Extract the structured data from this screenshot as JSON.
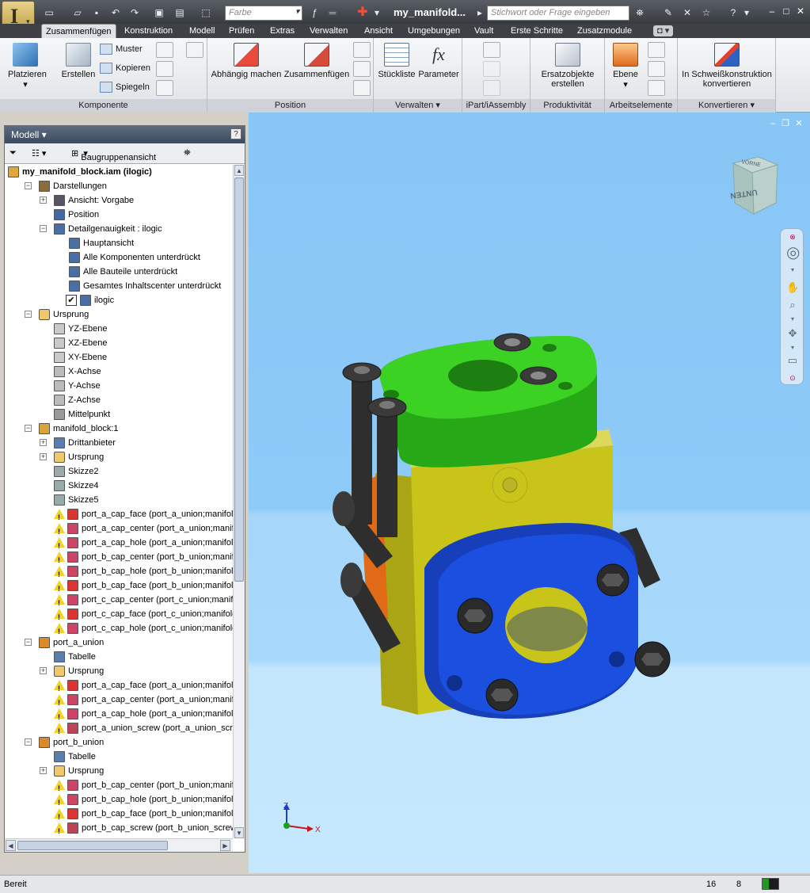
{
  "titlebar": {
    "app_icon": "inventor-app-icon",
    "color_placeholder": "Farbe",
    "doc_title": "my_manifold...",
    "search_placeholder": "Stichwort oder Frage eingeben"
  },
  "tabs": [
    "Zusammenfügen",
    "Konstruktion",
    "Modell",
    "Prüfen",
    "Extras",
    "Verwalten",
    "Ansicht",
    "Umgebungen",
    "Vault",
    "Erste Schritte",
    "Zusatzmodule"
  ],
  "ribbon": {
    "groups": {
      "komponente": "Komponente",
      "position": "Position",
      "verwalten": "Verwalten",
      "ipart": "iPart/iAssembly",
      "produktivitaet": "Produktivität",
      "arbeitselemente": "Arbeitselemente",
      "konvertieren": "Konvertieren"
    },
    "platzieren": "Platzieren",
    "erstellen": "Erstellen",
    "muster": "Muster",
    "kopieren": "Kopieren",
    "spiegeln": "Spiegeln",
    "abhaengig": "Abhängig machen",
    "zusammenfuegen": "Zusammenfügen",
    "stueckliste": "Stückliste",
    "parameter": "Parameter",
    "ersatz_1": "Ersatzobjekte",
    "ersatz_2": "erstellen",
    "ebene": "Ebene",
    "schweiss_1": "In Schweißkonstruktion",
    "schweiss_2": "konvertieren"
  },
  "panel": {
    "title": "Modell",
    "view_mode": "Baugruppenansicht",
    "tree": [
      {
        "level": 0,
        "toggle": "",
        "icon": "assembly",
        "label": "my_manifold_block.iam (ilogic)",
        "bold": true
      },
      {
        "level": 1,
        "toggle": "−",
        "icon": "representations",
        "label": "Darstellungen"
      },
      {
        "level": 2,
        "toggle": "+",
        "icon": "view",
        "label": "Ansicht: Vorgabe"
      },
      {
        "level": 2,
        "toggle": "",
        "icon": "position",
        "label": "Position"
      },
      {
        "level": 2,
        "toggle": "−",
        "icon": "lod",
        "label": "Detailgenauigkeit : ilogic"
      },
      {
        "level": 3,
        "toggle": "",
        "icon": "lod",
        "label": "Hauptansicht"
      },
      {
        "level": 3,
        "toggle": "",
        "icon": "lod",
        "label": "Alle Komponenten unterdrückt"
      },
      {
        "level": 3,
        "toggle": "",
        "icon": "lod",
        "label": "Alle Bauteile unterdrückt"
      },
      {
        "level": 3,
        "toggle": "",
        "icon": "lod",
        "label": "Gesamtes Inhaltscenter unterdrückt"
      },
      {
        "level": 3,
        "toggle": "",
        "icon": "lod-checked",
        "label": "ilogic"
      },
      {
        "level": 1,
        "toggle": "−",
        "icon": "folder",
        "label": "Ursprung"
      },
      {
        "level": 2,
        "toggle": "",
        "icon": "plane",
        "label": "YZ-Ebene"
      },
      {
        "level": 2,
        "toggle": "",
        "icon": "plane",
        "label": "XZ-Ebene"
      },
      {
        "level": 2,
        "toggle": "",
        "icon": "plane",
        "label": "XY-Ebene"
      },
      {
        "level": 2,
        "toggle": "",
        "icon": "axis",
        "label": "X-Achse"
      },
      {
        "level": 2,
        "toggle": "",
        "icon": "axis",
        "label": "Y-Achse"
      },
      {
        "level": 2,
        "toggle": "",
        "icon": "axis",
        "label": "Z-Achse"
      },
      {
        "level": 2,
        "toggle": "",
        "icon": "point",
        "label": "Mittelpunkt"
      },
      {
        "level": 1,
        "toggle": "−",
        "icon": "part",
        "label": "manifold_block:1"
      },
      {
        "level": 2,
        "toggle": "+",
        "icon": "thirdparty",
        "label": "Drittanbieter"
      },
      {
        "level": 2,
        "toggle": "+",
        "icon": "folder",
        "label": "Ursprung"
      },
      {
        "level": 2,
        "toggle": "",
        "icon": "sketch",
        "label": "Skizze2"
      },
      {
        "level": 2,
        "toggle": "",
        "icon": "sketch",
        "label": "Skizze4"
      },
      {
        "level": 2,
        "toggle": "",
        "icon": "sketch",
        "label": "Skizze5"
      },
      {
        "level": 2,
        "toggle": "",
        "icon": "constraint-face",
        "warn": true,
        "label": "port_a_cap_face (port_a_union;manifold_b"
      },
      {
        "level": 2,
        "toggle": "",
        "icon": "constraint-center",
        "warn": true,
        "label": "port_a_cap_center (port_a_union;manifolc"
      },
      {
        "level": 2,
        "toggle": "",
        "icon": "constraint-center",
        "warn": true,
        "label": "port_a_cap_hole (port_a_union;manifold_b"
      },
      {
        "level": 2,
        "toggle": "",
        "icon": "constraint-center",
        "warn": true,
        "label": "port_b_cap_center (port_b_union;manifolc"
      },
      {
        "level": 2,
        "toggle": "",
        "icon": "constraint-center",
        "warn": true,
        "label": "port_b_cap_hole (port_b_union;manifold_b"
      },
      {
        "level": 2,
        "toggle": "",
        "icon": "constraint-face",
        "warn": true,
        "label": "port_b_cap_face (port_b_union;manifold_b"
      },
      {
        "level": 2,
        "toggle": "",
        "icon": "constraint-center",
        "warn": true,
        "label": "port_c_cap_center (port_c_union;manifold"
      },
      {
        "level": 2,
        "toggle": "",
        "icon": "constraint-face",
        "warn": true,
        "label": "port_c_cap_face (port_c_union;manifold_b"
      },
      {
        "level": 2,
        "toggle": "",
        "icon": "constraint-center",
        "warn": true,
        "label": "port_c_cap_hole (port_c_union;manifold_b"
      },
      {
        "level": 1,
        "toggle": "−",
        "icon": "ipart",
        "label": "port_a_union"
      },
      {
        "level": 2,
        "toggle": "",
        "icon": "table",
        "label": "Tabelle"
      },
      {
        "level": 2,
        "toggle": "+",
        "icon": "folder",
        "label": "Ursprung"
      },
      {
        "level": 2,
        "toggle": "",
        "icon": "constraint-face",
        "warn": true,
        "label": "port_a_cap_face (port_a_union;manifold_b"
      },
      {
        "level": 2,
        "toggle": "",
        "icon": "constraint-center",
        "warn": true,
        "label": "port_a_cap_center (port_a_union;manifolc"
      },
      {
        "level": 2,
        "toggle": "",
        "icon": "constraint-center",
        "warn": true,
        "label": "port_a_cap_hole (port_a_union;manifold_b"
      },
      {
        "level": 2,
        "toggle": "",
        "icon": "constraint-screw",
        "warn": true,
        "label": "port_a_union_screw (port_a_union_screw;"
      },
      {
        "level": 1,
        "toggle": "−",
        "icon": "ipart",
        "label": "port_b_union"
      },
      {
        "level": 2,
        "toggle": "",
        "icon": "table",
        "label": "Tabelle"
      },
      {
        "level": 2,
        "toggle": "+",
        "icon": "folder",
        "label": "Ursprung"
      },
      {
        "level": 2,
        "toggle": "",
        "icon": "constraint-center",
        "warn": true,
        "label": "port_b_cap_center (port_b_union;manifolc"
      },
      {
        "level": 2,
        "toggle": "",
        "icon": "constraint-center",
        "warn": true,
        "label": "port_b_cap_hole (port_b_union;manifold_b"
      },
      {
        "level": 2,
        "toggle": "",
        "icon": "constraint-face",
        "warn": true,
        "label": "port_b_cap_face (port_b_union;manifold_b"
      },
      {
        "level": 2,
        "toggle": "",
        "icon": "constraint-screw",
        "warn": true,
        "label": "port_b_cap_screw (port_b_union_screw;pc"
      }
    ]
  },
  "viewcube": {
    "face_label": "UNTEN",
    "top_label": "VORNE"
  },
  "triad": {
    "z": "Z",
    "x": "X"
  },
  "status": {
    "text": "Bereit",
    "count_a": "16",
    "count_b": "8"
  },
  "colors": {
    "flange_green": "#2fc21b",
    "flange_blue": "#1a4fe0",
    "block_yellow": "#c8c41a",
    "port_orange": "#e06a16",
    "screw_dark": "#2e2e2e",
    "viewport_sky": "#8dcaf8"
  }
}
